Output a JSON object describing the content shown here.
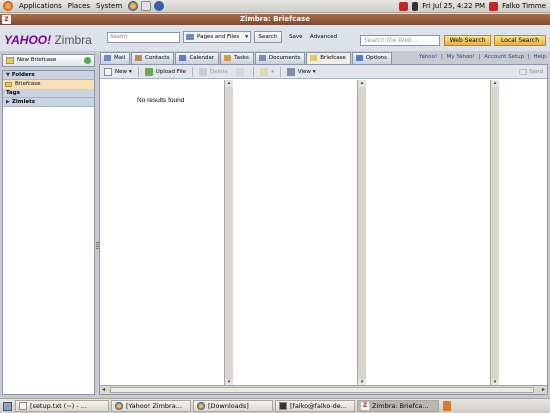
{
  "top_panel": {
    "menus": [
      "Applications",
      "Places",
      "System"
    ],
    "clock": "Fri Jul 25,  4:22 PM",
    "user": "Falko Timme"
  },
  "window": {
    "title": "Zimbra: Briefcase"
  },
  "header": {
    "logo_yahoo": "YAHOO!",
    "logo_zimbra": "Zimbra",
    "search_placeholder": "Search",
    "search_scope": "Pages and Files",
    "search_button": "Search",
    "save_link": "Save",
    "advanced_link": "Advanced",
    "web_search_placeholder": "Search the Web...",
    "web_search_button": "Web Search",
    "local_search_button": "Local Search"
  },
  "new_briefcase_label": "New Briefcase",
  "tabs": [
    {
      "label": "Mail",
      "icon": "mail-icon",
      "color": "#6d8bc0"
    },
    {
      "label": "Contacts",
      "icon": "contacts-icon",
      "color": "#c08a4a"
    },
    {
      "label": "Calendar",
      "icon": "calendar-icon",
      "color": "#5a7fbf"
    },
    {
      "label": "Tasks",
      "icon": "tasks-icon",
      "color": "#d0a040"
    },
    {
      "label": "Documents",
      "icon": "documents-icon",
      "color": "#7a8fb0"
    },
    {
      "label": "Briefcase",
      "icon": "briefcase-icon",
      "color": "#e6c56b"
    },
    {
      "label": "Options",
      "icon": "options-icon",
      "color": "#5a7fbf"
    }
  ],
  "active_tab": "Briefcase",
  "top_links": [
    "Yahoo!",
    "My Yahoo!",
    "Account Setup",
    "Help"
  ],
  "top_links_separator": "|",
  "sidebar": {
    "folders_header": "Folders",
    "folders": [
      {
        "label": "Briefcase",
        "selected": true
      }
    ],
    "tags_header": "Tags",
    "zimlets_header": "Zimlets"
  },
  "toolbar": {
    "new": "New",
    "upload": "Upload File",
    "delete": "Delete",
    "view": "View",
    "send": "Send"
  },
  "main": {
    "empty_message": "No results found"
  },
  "taskbar": {
    "tasks": [
      {
        "label": "[setup.txt (~) - ...",
        "icon": "text-editor-icon",
        "active": false
      },
      {
        "label": "[Yahoo! Zimbra...",
        "icon": "firefox-icon",
        "active": false
      },
      {
        "label": "[Downloads]",
        "icon": "downloads-icon",
        "active": false
      },
      {
        "label": "[falko@falko-de...",
        "icon": "terminal-icon",
        "active": false
      },
      {
        "label": "Zimbra: Briefca...",
        "icon": "zimbra-icon",
        "active": true
      }
    ]
  }
}
